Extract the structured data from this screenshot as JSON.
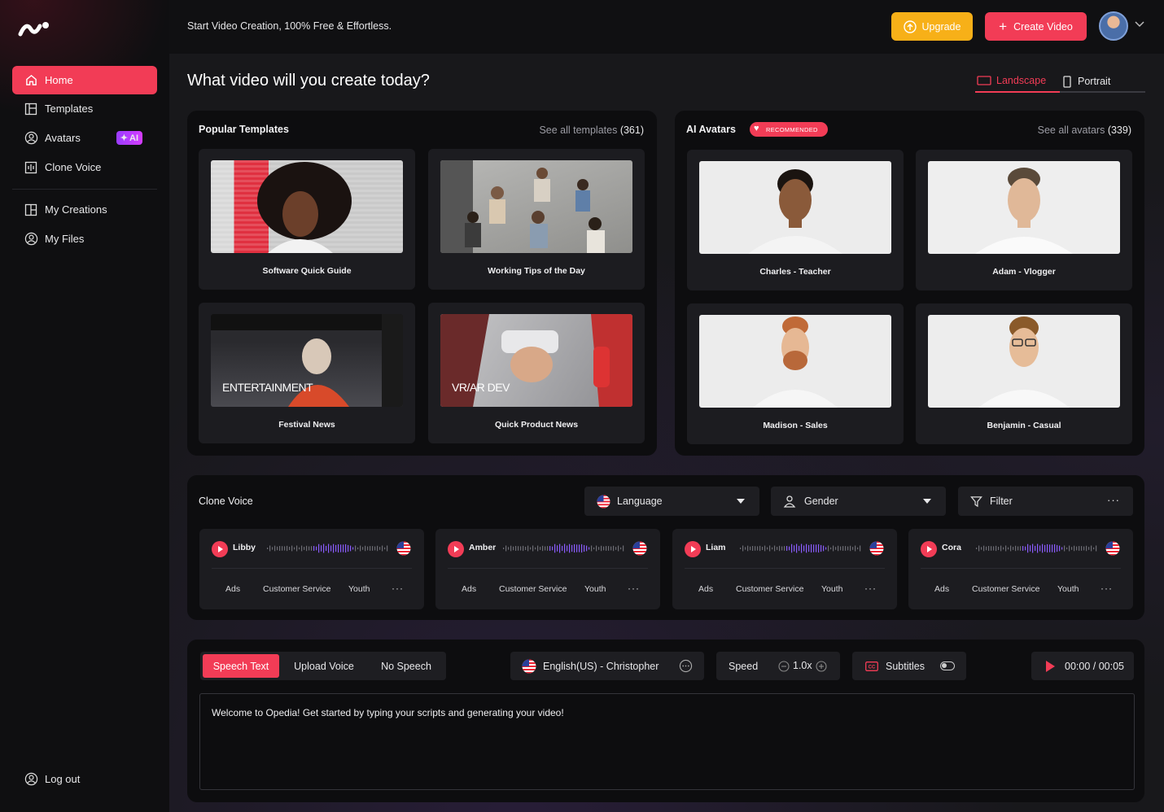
{
  "app": {
    "tagline": "Start Video Creation, 100% Free & Effortless.",
    "upgrade_label": "Upgrade",
    "create_label": "Create Video"
  },
  "sidebar": {
    "items": [
      {
        "label": "Home"
      },
      {
        "label": "Templates"
      },
      {
        "label": "Avatars",
        "badge": "AI"
      },
      {
        "label": "Clone Voice"
      },
      {
        "label": "My Creations"
      },
      {
        "label": "My Files"
      }
    ],
    "logout_label": "Log out"
  },
  "main": {
    "title": "What video will you create today?",
    "orientation": {
      "landscape": "Landscape",
      "portrait": "Portrait",
      "selected": "Landscape"
    }
  },
  "templates": {
    "title": "Popular Templates",
    "see_all": "See all templates",
    "count": "(361)",
    "items": [
      {
        "caption": "Software Quick Guide",
        "overlay": ""
      },
      {
        "caption": "Working Tips of the Day",
        "overlay": ""
      },
      {
        "caption": "Festival News",
        "overlay": "ENTERTAINMENT"
      },
      {
        "caption": "Quick Product News",
        "overlay": "VR/AR DEV"
      }
    ]
  },
  "avatars": {
    "title": "AI Avatars",
    "badge": "RECOMMENDED",
    "see_all": "See all avatars",
    "count": "(339)",
    "items": [
      {
        "caption": "Charles - Teacher"
      },
      {
        "caption": "Adam - Vlogger"
      },
      {
        "caption": "Madison - Sales"
      },
      {
        "caption": "Benjamin - Casual"
      }
    ]
  },
  "clone_voice": {
    "title": "Clone Voice",
    "language_label": "Language",
    "gender_label": "Gender",
    "filter_label": "Filter",
    "voices": [
      {
        "name": "Libby",
        "tags": [
          "Ads",
          "Customer Service",
          "Youth"
        ]
      },
      {
        "name": "Amber",
        "tags": [
          "Ads",
          "Customer Service",
          "Youth"
        ]
      },
      {
        "name": "Liam",
        "tags": [
          "Ads",
          "Customer Service",
          "Youth"
        ]
      },
      {
        "name": "Cora",
        "tags": [
          "Ads",
          "Customer Service",
          "Youth"
        ]
      }
    ]
  },
  "speech": {
    "tabs": [
      "Speech Text",
      "Upload Voice",
      "No Speech"
    ],
    "active_tab": "Speech Text",
    "voice": "English(US) - Christopher",
    "speed_label": "Speed",
    "speed_value": "1.0x",
    "subtitles_label": "Subtitles",
    "subtitles_on": false,
    "time": "00:00 / 00:05",
    "script": "Welcome to Opedia! Get started by typing your scripts and generating your video!"
  },
  "colors": {
    "accent": "#f23c56",
    "upgrade": "#f7b018",
    "ai_badge": "#b23cff"
  }
}
